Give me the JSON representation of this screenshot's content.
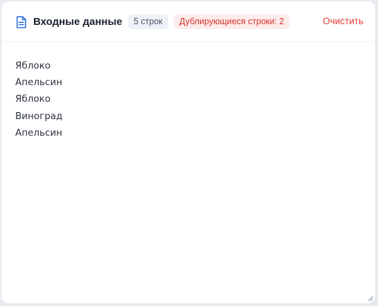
{
  "panel": {
    "title": "Входные данные",
    "title_icon": "document-icon",
    "line_count_badge": "5 строк",
    "duplicates_badge": "Дублирующиеся строки: 2",
    "clear_label": "Очистить"
  },
  "input_lines": [
    "Яблоко",
    "Апельсин",
    "Яблоко",
    "Виноград",
    "Апельсин"
  ],
  "colors": {
    "accent": "#2f6fe0",
    "danger": "#e53935",
    "danger_bg": "#fdecec",
    "badge_bg": "#eef2f7"
  }
}
